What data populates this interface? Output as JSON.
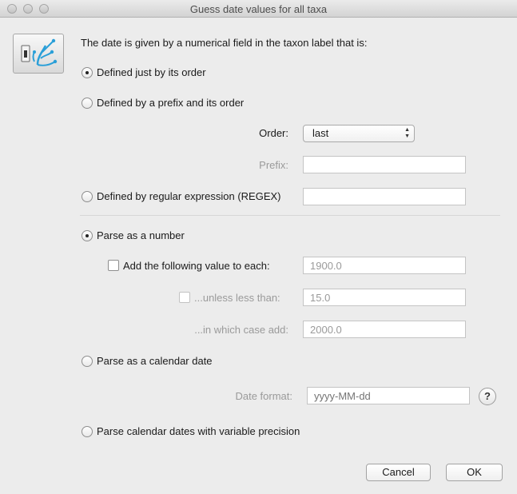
{
  "window": {
    "title": "Guess date values for all taxa"
  },
  "header": {
    "text": "The date is given by a numerical field in the taxon label that is:"
  },
  "options": {
    "by_order": "Defined just by its order",
    "by_prefix_order": "Defined by a prefix and its order",
    "by_regex": "Defined by regular expression (REGEX)"
  },
  "order": {
    "label": "Order:",
    "value": "last"
  },
  "prefix": {
    "label": "Prefix:",
    "value": ""
  },
  "regex": {
    "value": ""
  },
  "parse_number": {
    "label": "Parse as a number",
    "add_value_label": "Add the following value to each:",
    "add_value": "1900.0",
    "unless_label": "...unless less than:",
    "unless_value": "15.0",
    "in_which_case_label": "...in which case add:",
    "in_which_case_value": "2000.0"
  },
  "parse_calendar": {
    "label": "Parse as a calendar date",
    "date_format_label": "Date format:",
    "date_format_placeholder": "yyyy-MM-dd"
  },
  "parse_variable": {
    "label": "Parse calendar dates with variable precision"
  },
  "help": {
    "glyph": "?"
  },
  "buttons": {
    "cancel": "Cancel",
    "ok": "OK"
  },
  "selection": {
    "source": "by_order",
    "parse": "number"
  }
}
